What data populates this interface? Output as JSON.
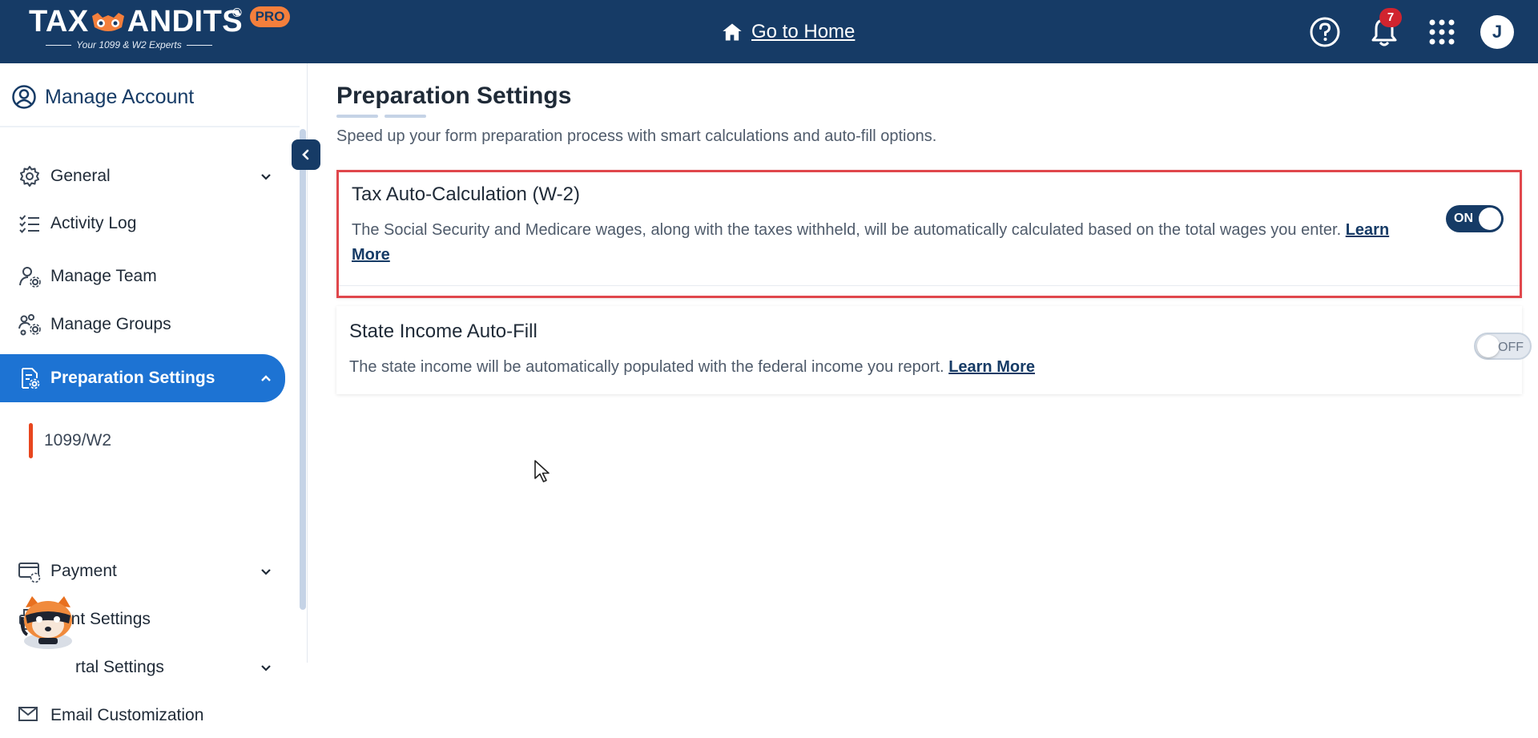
{
  "header": {
    "logo_text_left": "TAX",
    "logo_text_right": "ANDITS",
    "logo_registered": "®",
    "logo_badge": "PRO",
    "logo_tagline": "Your 1099 & W2 Experts",
    "home_link": "Go to Home",
    "notification_count": "7",
    "avatar_initial": "J"
  },
  "sidebar": {
    "manage_account": "Manage Account",
    "items": [
      {
        "label": "General",
        "icon": "gear-icon"
      },
      {
        "label": "Activity Log",
        "icon": "checklist-icon"
      },
      {
        "label": "Manage Team",
        "icon": "user-gear-icon"
      },
      {
        "label": "Manage Groups",
        "icon": "users-gear-icon"
      },
      {
        "label": "Preparation Settings",
        "icon": "document-gear-icon"
      },
      {
        "label": "1099/W2"
      },
      {
        "label": "Payment",
        "icon": "card-gear-icon"
      },
      {
        "label": "Print Settings",
        "icon": "printer-icon"
      },
      {
        "label": "rtal Settings",
        "icon": "portal-icon"
      },
      {
        "label": "Email Customization",
        "icon": "email-gear-icon"
      }
    ]
  },
  "main": {
    "title": "Preparation Settings",
    "subtitle": "Speed up your form preparation process with smart calculations and auto-fill options.",
    "cards": [
      {
        "title": "Tax Auto-Calculation (W-2)",
        "text": "The Social Security and Medicare wages, along with the taxes withheld, will be automatically calculated based on the total wages you enter.",
        "link": "Learn More",
        "toggle": "ON"
      },
      {
        "title": "State Income Auto-Fill",
        "text": "The state income will be automatically populated with the federal income you report.",
        "link": "Learn More",
        "toggle": "OFF"
      }
    ]
  },
  "colors": {
    "header_bg": "#163b66",
    "active_item": "#1d73d3",
    "accent_orange": "#f47f3c",
    "highlight_border": "#e0474c"
  }
}
